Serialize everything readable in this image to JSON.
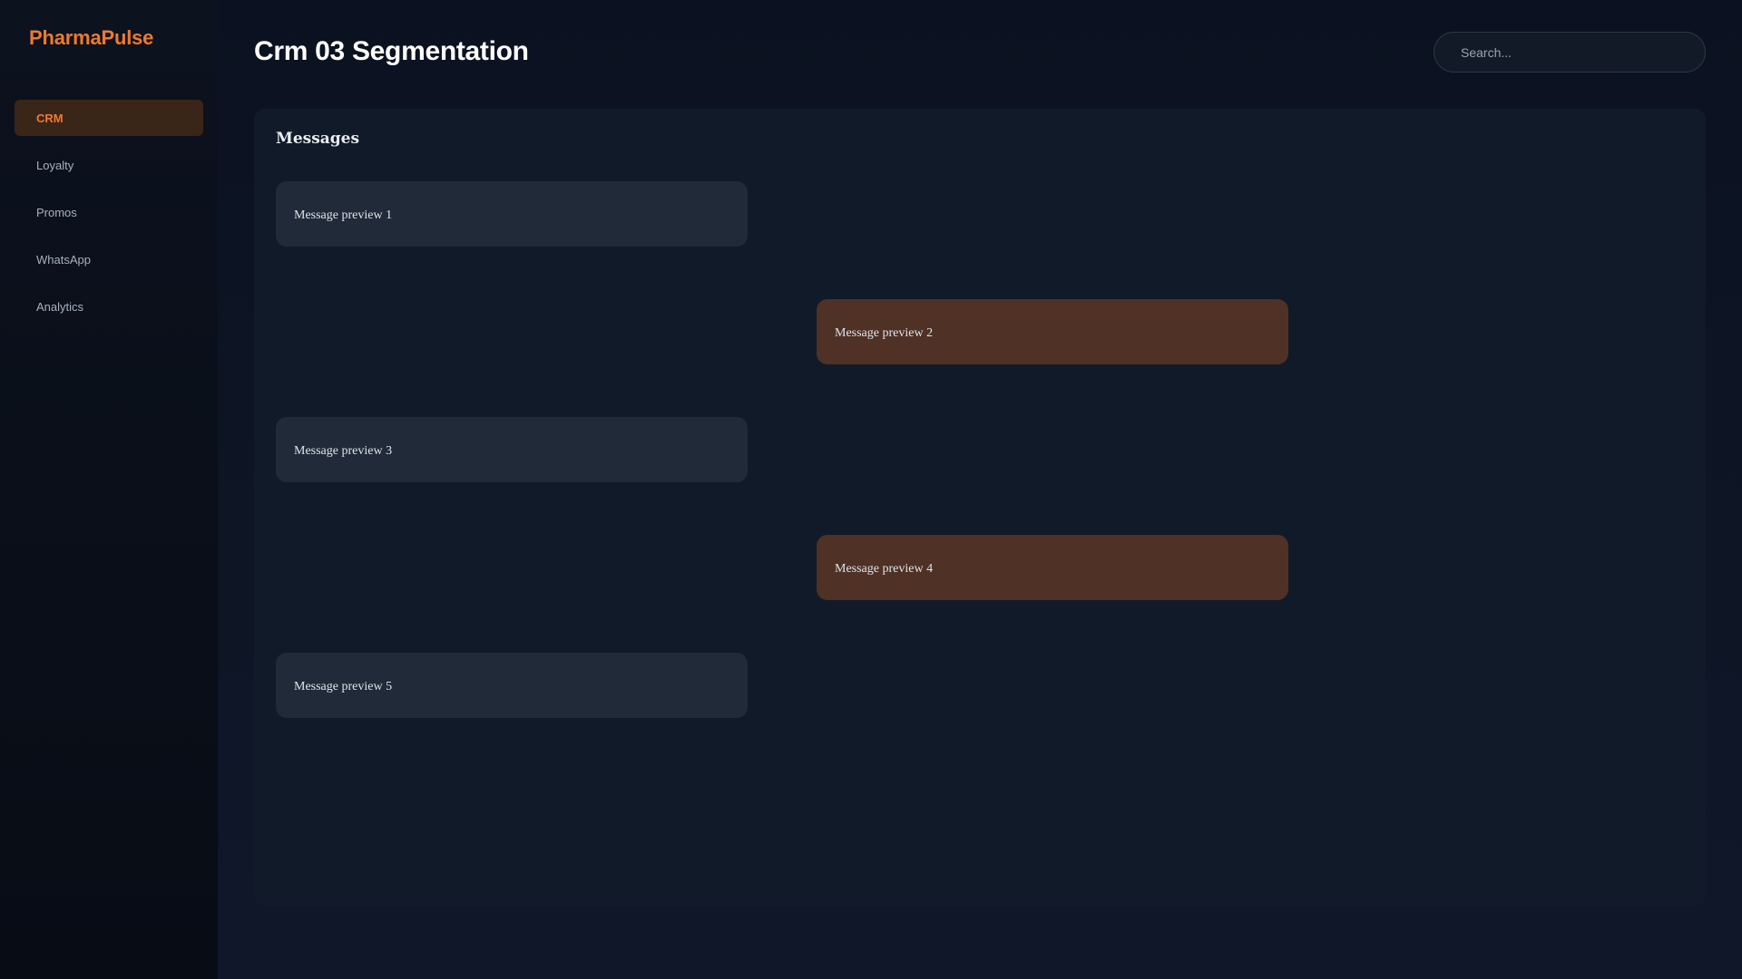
{
  "app": {
    "brand": "PharmaPulse"
  },
  "sidebar": {
    "items": [
      {
        "label": "CRM",
        "active": true
      },
      {
        "label": "Loyalty",
        "active": false
      },
      {
        "label": "Promos",
        "active": false
      },
      {
        "label": "WhatsApp",
        "active": false
      },
      {
        "label": "Analytics",
        "active": false
      }
    ]
  },
  "header": {
    "title": "Crm 03 Segmentation",
    "search_placeholder": "Search..."
  },
  "messages": {
    "title": "Messages",
    "items": [
      {
        "text": "Message preview 1",
        "direction": "incoming"
      },
      {
        "text": "Message preview 2",
        "direction": "outgoing"
      },
      {
        "text": "Message preview 3",
        "direction": "incoming"
      },
      {
        "text": "Message preview 4",
        "direction": "outgoing"
      },
      {
        "text": "Message preview 5",
        "direction": "incoming"
      }
    ]
  },
  "colors": {
    "accent": "#ee7a2e",
    "active_nav_bg": "#3a2519",
    "incoming_bubble": "#202a38",
    "outgoing_bubble": "#4f3125",
    "panel_bg": "#111a29"
  }
}
